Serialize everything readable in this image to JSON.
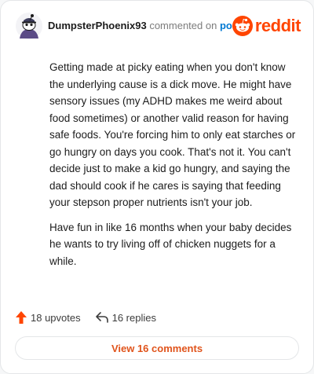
{
  "header": {
    "username": "DumpsterPhoenix93",
    "action_text": "commented on",
    "post_link": "post",
    "brand": "reddit"
  },
  "comment": {
    "paragraphs": [
      "Getting made at picky eating when you don't know the underlying cause is a dick move. He might have sensory issues (my ADHD makes me weird about food sometimes) or another valid reason for having safe foods. You're forcing him to only eat starches or go hungry on days you cook. That's not it. You can't decide just to make a kid go hungry, and saying the dad should cook if he cares is saying that feeding your stepson proper nutrients isn't your job.",
      "Have fun in like 16 months when your baby decides he wants to try living off of chicken nuggets for a while."
    ]
  },
  "stats": {
    "upvotes": "18 upvotes",
    "replies": "16 replies"
  },
  "footer": {
    "view_comments": "View 16 comments"
  },
  "colors": {
    "brand": "#ff4500",
    "link": "#0079d3",
    "upvote": "#ff4500",
    "view_button_text": "#e0541c"
  },
  "icons": {
    "avatar": "snoo-avatar-icon",
    "brand": "reddit-logo-icon",
    "upvote": "upvote-arrow-icon",
    "reply": "reply-arrow-icon"
  }
}
